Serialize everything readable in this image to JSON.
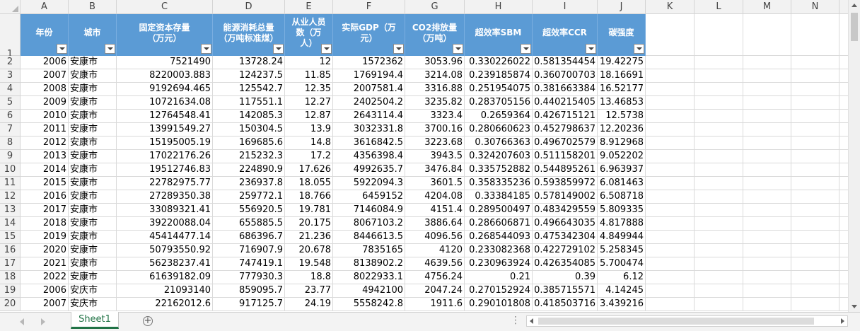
{
  "columns": [
    "A",
    "B",
    "C",
    "D",
    "E",
    "F",
    "G",
    "H",
    "I",
    "J",
    "K",
    "L",
    "M",
    "N",
    "O"
  ],
  "row_numbers": [
    "1",
    "2",
    "3",
    "4",
    "5",
    "6",
    "7",
    "8",
    "9",
    "10",
    "11",
    "12",
    "13",
    "14",
    "15",
    "16",
    "17",
    "18",
    "19",
    "20"
  ],
  "headers": [
    {
      "lines": [
        "年份"
      ]
    },
    {
      "lines": [
        "城市"
      ]
    },
    {
      "lines": [
        "固定资本存量",
        "（万元）"
      ]
    },
    {
      "lines": [
        "能源消耗总量",
        "（万吨标准煤）"
      ]
    },
    {
      "lines": [
        "从业人员",
        "数（万",
        "人）"
      ]
    },
    {
      "lines": [
        "实际GDP（万",
        "元）"
      ]
    },
    {
      "lines": [
        "CO2排放量",
        "（万吨）"
      ]
    },
    {
      "lines": [
        "超效率SBM"
      ]
    },
    {
      "lines": [
        "超效率CCR"
      ]
    },
    {
      "lines": [
        "碳强度"
      ]
    }
  ],
  "rows": [
    [
      "2006",
      "安康市",
      "7521490",
      "13728.24",
      "12",
      "1572362",
      "3053.96",
      "0.330226022",
      "0.581354454",
      "19.42275"
    ],
    [
      "2007",
      "安康市",
      "8220003.883",
      "124237.5",
      "11.85",
      "1769194.4",
      "3214.08",
      "0.239185874",
      "0.360700703",
      "18.16691"
    ],
    [
      "2008",
      "安康市",
      "9192694.465",
      "125542.7",
      "12.35",
      "2007581.4",
      "3316.88",
      "0.251954075",
      "0.381663384",
      "16.52177"
    ],
    [
      "2009",
      "安康市",
      "10721634.08",
      "117551.1",
      "12.27",
      "2402504.2",
      "3235.82",
      "0.283705156",
      "0.440215405",
      "13.46853"
    ],
    [
      "2010",
      "安康市",
      "12764548.41",
      "142085.3",
      "12.87",
      "2643114.4",
      "3323.4",
      "0.2659364",
      "0.426715121",
      "12.5738"
    ],
    [
      "2011",
      "安康市",
      "13991549.27",
      "150304.5",
      "13.9",
      "3032331.8",
      "3700.16",
      "0.280660623",
      "0.452798637",
      "12.20236"
    ],
    [
      "2012",
      "安康市",
      "15195005.19",
      "169685.6",
      "14.8",
      "3616842.5",
      "3223.68",
      "0.30766363",
      "0.496702579",
      "8.912968"
    ],
    [
      "2013",
      "安康市",
      "17022176.26",
      "215232.3",
      "17.2",
      "4356398.4",
      "3943.5",
      "0.324207603",
      "0.511158201",
      "9.052202"
    ],
    [
      "2014",
      "安康市",
      "19512746.83",
      "224890.9",
      "17.626",
      "4992635.7",
      "3476.84",
      "0.335752882",
      "0.544895261",
      "6.963937"
    ],
    [
      "2015",
      "安康市",
      "22782975.77",
      "236937.8",
      "18.055",
      "5922094.3",
      "3601.5",
      "0.358335236",
      "0.593859972",
      "6.081463"
    ],
    [
      "2016",
      "安康市",
      "27289350.38",
      "259772.1",
      "18.766",
      "6459152",
      "4204.08",
      "0.33384185",
      "0.578149002",
      "6.508718"
    ],
    [
      "2017",
      "安康市",
      "33089321.41",
      "556920.5",
      "19.781",
      "7146084.9",
      "4151.4",
      "0.289500497",
      "0.483429559",
      "5.809335"
    ],
    [
      "2018",
      "安康市",
      "39220088.04",
      "655885.5",
      "20.175",
      "8067103.2",
      "3886.64",
      "0.286606871",
      "0.496643035",
      "4.817888"
    ],
    [
      "2019",
      "安康市",
      "45414477.14",
      "686396.7",
      "21.236",
      "8446613.5",
      "4096.56",
      "0.268544093",
      "0.475342304",
      "4.849944"
    ],
    [
      "2020",
      "安康市",
      "50793550.92",
      "716907.9",
      "20.678",
      "7835165",
      "4120",
      "0.233082368",
      "0.422729102",
      "5.258345"
    ],
    [
      "2021",
      "安康市",
      "56238237.41",
      "747419.1",
      "19.548",
      "8138902.2",
      "4639.56",
      "0.230963924",
      "0.426354085",
      "5.700474"
    ],
    [
      "2022",
      "安康市",
      "61639182.09",
      "777930.3",
      "18.8",
      "8022933.1",
      "4756.24",
      "0.21",
      "0.39",
      "6.12"
    ],
    [
      "2006",
      "安庆市",
      "21093140",
      "859095.7",
      "23.77",
      "4942100",
      "2047.24",
      "0.270152924",
      "0.385715571",
      "4.14245"
    ],
    [
      "2007",
      "安庆市",
      "22162012.6",
      "917125.7",
      "24.19",
      "5558242.8",
      "1911.6",
      "0.290101808",
      "0.418503716",
      "3.439216"
    ]
  ],
  "sheet_tab": "Sheet1",
  "header_color": "#5b9bd5",
  "accent_color": "#217346"
}
